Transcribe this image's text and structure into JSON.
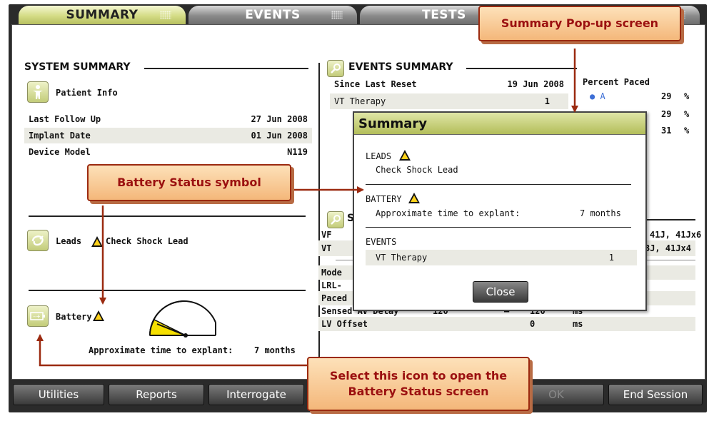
{
  "tabs": [
    {
      "label": "SUMMARY"
    },
    {
      "label": "EVENTS"
    },
    {
      "label": "TESTS"
    }
  ],
  "system_summary": {
    "title": "SYSTEM SUMMARY",
    "patient_info": "Patient Info",
    "rows": [
      {
        "label": "Last Follow Up",
        "value": "27 Jun 2008"
      },
      {
        "label": "Implant Date",
        "value": "01 Jun 2008"
      },
      {
        "label": "Device Model",
        "value": "N119"
      }
    ],
    "leads_label": "Leads",
    "leads_status": "Check Shock Lead",
    "battery_label": "Battery",
    "explant_label": "Approximate time to explant:",
    "explant_value": "7 months"
  },
  "events_summary": {
    "title": "EVENTS SUMMARY",
    "since_label": "Since Last Reset",
    "since_value": "19 Jun 2008",
    "vt_label": "VT Therapy",
    "vt_value": "1",
    "percent_paced_label": "Percent Paced",
    "paced": [
      {
        "label": "A",
        "value": "29",
        "unit": "%"
      },
      {
        "label": "",
        "value": "29",
        "unit": "%"
      },
      {
        "label": "",
        "value": "31",
        "unit": "%"
      }
    ]
  },
  "settings": {
    "title_partial": "S",
    "vf_label": "VF",
    "vf_value": "41J, 41Jx6",
    "vt_label": "VT",
    "vt_value": ".3J, 41Jx4",
    "rows": [
      {
        "label": "Mode"
      },
      {
        "label": "LRL-"
      },
      {
        "label": "Paced"
      },
      {
        "label": "Sensed AV Delay",
        "v1": "120",
        "sep": "–",
        "v2": "120",
        "unit": "ms"
      },
      {
        "label": "LV Offset",
        "v2": "0",
        "unit": "ms"
      }
    ]
  },
  "popup": {
    "title": "Summary",
    "leads_heading": "LEADS",
    "leads_text": "Check Shock Lead",
    "battery_heading": "BATTERY",
    "battery_label": "Approximate time to explant:",
    "battery_value": "7 months",
    "events_heading": "EVENTS",
    "event_label": "VT Therapy",
    "event_value": "1",
    "close": "Close"
  },
  "bottom_buttons": {
    "utilities": "Utilities",
    "reports": "Reports",
    "interrogate": "Interrogate",
    "ok": "OK",
    "end_session": "End Session"
  },
  "callouts": {
    "popup": "Summary Pop-up screen",
    "battery_symbol": "Battery Status symbol",
    "select_icon_line1": "Select this icon to open the",
    "select_icon_line2": "Battery Status screen"
  },
  "colors": {
    "accent": "#c3cc79",
    "callout_border": "#9b2a10",
    "callout_text": "#9b1010",
    "warning": "#ffd21a",
    "pace_dot": "#3d6fd6"
  }
}
